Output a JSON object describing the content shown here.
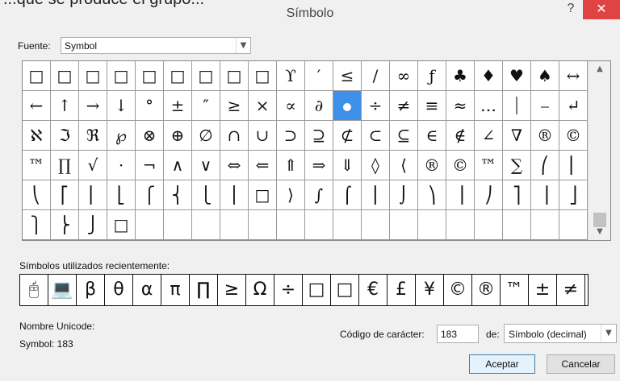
{
  "window": {
    "cut_text": "...que se produce el grupo...",
    "title": "Símbolo",
    "help_label": "?",
    "close_label": "✕"
  },
  "font": {
    "label": "Fuente:",
    "value": "Symbol"
  },
  "grid": {
    "selected_symbol": "•",
    "rows": [
      [
        "□",
        "□",
        "□",
        "□",
        "□",
        "□",
        "□",
        "□",
        "□",
        "ϒ",
        "′",
        "≤",
        "/",
        "∞",
        "ƒ",
        "♣",
        "♦",
        "♥",
        "♠",
        "↔"
      ],
      [
        "←",
        "↑",
        "→",
        "↓",
        "°",
        "±",
        "″",
        "≥",
        "×",
        "∝",
        "∂",
        "•",
        "÷",
        "≠",
        "≡",
        "≈",
        "…",
        "⏐",
        "⎯",
        "↵"
      ],
      [
        "ℵ",
        "ℑ",
        "ℜ",
        "℘",
        "⊗",
        "⊕",
        "∅",
        "∩",
        "∪",
        "⊃",
        "⊇",
        "⊄",
        "⊂",
        "⊆",
        "∈",
        "∉",
        "∠",
        "∇",
        "®",
        "©"
      ],
      [
        "™",
        "∏",
        "√",
        "·",
        "¬",
        "∧",
        "∨",
        "⇔",
        "⇐",
        "⇑",
        "⇒",
        "⇓",
        "◊",
        "⟨",
        "®",
        "©",
        "™",
        "∑",
        "⎛",
        "⎜"
      ],
      [
        "⎝",
        "⎡",
        "⎢",
        "⎣",
        "⎧",
        "⎨",
        "⎩",
        "⎪",
        "□",
        "⟩",
        "∫",
        "⌠",
        "⎮",
        "⌡",
        "⎞",
        "⎟",
        "⎠",
        "⎤",
        "⎥",
        "⎦"
      ],
      [
        "⎫",
        "⎬",
        "⎭",
        "□",
        "",
        "",
        "",
        "",
        "",
        "",
        "",
        "",
        "",
        "",
        "",
        "",
        "",
        "",
        "",
        ""
      ]
    ]
  },
  "recent": {
    "label": "Símbolos utilizados recientemente:",
    "items": [
      "🖰",
      "💻",
      "β",
      "θ",
      "α",
      "π",
      "∏",
      "≥",
      "Ω",
      "÷",
      "□",
      "□",
      "€",
      "£",
      "¥",
      "©",
      "®",
      "™",
      "±",
      "≠"
    ]
  },
  "unicode": {
    "label": "Nombre Unicode:",
    "value": "Symbol: 183"
  },
  "code": {
    "label": "Código de carácter:",
    "value": "183",
    "from_label": "de:",
    "from_value": "Símbolo (decimal)"
  },
  "buttons": {
    "accept": "Aceptar",
    "cancel": "Cancelar"
  }
}
